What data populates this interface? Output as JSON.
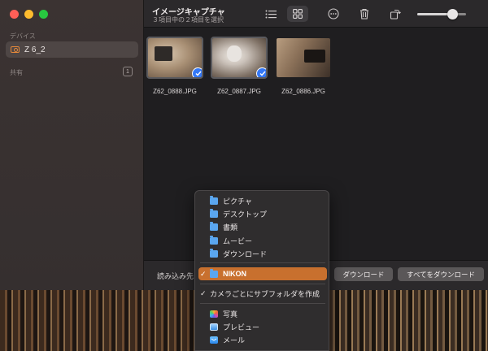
{
  "window": {
    "title": "イメージキャプチャ",
    "subtitle": "３項目中の２項目を選択"
  },
  "sidebar": {
    "devices_heading": "デバイス",
    "device_name": "Z 6_2",
    "shared_heading": "共有",
    "shared_count": "1"
  },
  "toolbar": {
    "list_view_icon": "list-icon",
    "grid_view_icon": "grid-icon",
    "grid_view_active": true,
    "more_icon": "ellipsis-circle-icon",
    "delete_icon": "trash-icon",
    "rotate_icon": "rotate-icon",
    "thumbnail_size_fraction": 0.72
  },
  "thumbnails": [
    {
      "filename": "Z62_0888.JPG",
      "selected": true
    },
    {
      "filename": "Z62_0887.JPG",
      "selected": true
    },
    {
      "filename": "Z62_0886.JPG",
      "selected": false
    }
  ],
  "bottombar": {
    "import_to_label": "読み込み先",
    "download_button": "ダウンロード",
    "download_all_button": "すべてをダウンロード"
  },
  "import_menu": {
    "items": [
      {
        "label": "ピクチャ",
        "icon": "folder-icon"
      },
      {
        "label": "デスクトップ",
        "icon": "folder-icon"
      },
      {
        "label": "書類",
        "icon": "folder-icon"
      },
      {
        "label": "ムービー",
        "icon": "folder-icon"
      },
      {
        "label": "ダウンロード",
        "icon": "folder-icon"
      }
    ],
    "selected_item": {
      "label": "NIKON",
      "icon": "folder-icon"
    },
    "option_subfolder": "カメラごとにサブフォルダを作成",
    "apps": [
      {
        "label": "写真",
        "icon": "photos-app-icon"
      },
      {
        "label": "プレビュー",
        "icon": "preview-app-icon"
      },
      {
        "label": "メール",
        "icon": "mail-app-icon"
      }
    ]
  },
  "colors": {
    "accent_selection": "#c8702e",
    "checkmark_blue": "#3478f6",
    "folder_blue": "#5aa6ef",
    "device_icon_orange": "#e6893a"
  }
}
